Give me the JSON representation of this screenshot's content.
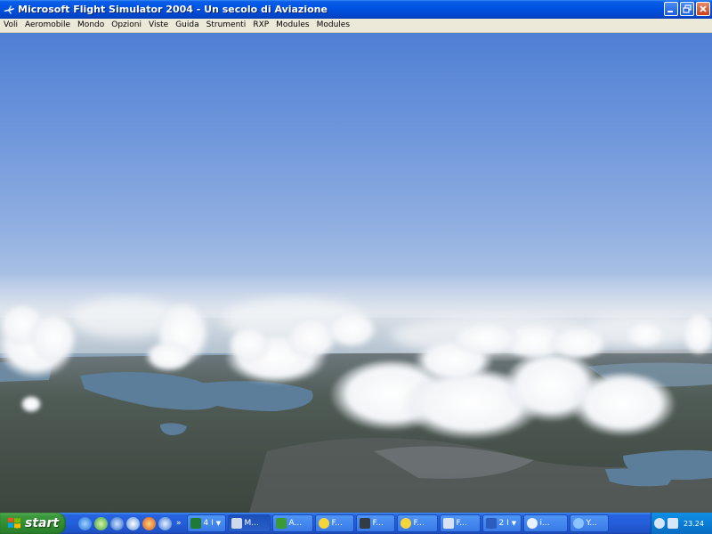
{
  "window": {
    "title": "Microsoft Flight Simulator 2004 - Un secolo di Aviazione",
    "buttons": [
      "minimize-icon",
      "restore-icon",
      "close-icon"
    ]
  },
  "menu": {
    "items": [
      "Voli",
      "Aeromobile",
      "Mondo",
      "Opzioni",
      "Viste",
      "Guida",
      "Strumenti",
      "RXP",
      "Modules",
      "Modules"
    ]
  },
  "taskbar": {
    "start_label": "start",
    "quick_launch_more": "»",
    "tasks": [
      {
        "label": "4 I",
        "icon": "excel-icon",
        "arrow": "▼"
      },
      {
        "label": "M...",
        "icon": "flight-simulator-icon",
        "active": true
      },
      {
        "label": "A...",
        "icon": "plant-icon"
      },
      {
        "label": "F...",
        "icon": "sun-icon"
      },
      {
        "label": "F...",
        "icon": "monitor-icon"
      },
      {
        "label": "F...",
        "icon": "sun-icon"
      },
      {
        "label": "F...",
        "icon": "plane-icon"
      },
      {
        "label": "2 I",
        "icon": "word-icon",
        "arrow": "▼"
      },
      {
        "label": "i...",
        "icon": "network-icon"
      },
      {
        "label": "Y...",
        "icon": "ie-icon"
      }
    ],
    "clock": "23.24"
  },
  "colors": {
    "titlebar": "#0054e3",
    "menubar": "#ece9d8",
    "taskbar": "#245edb",
    "start": "#3c9a3c",
    "tray": "#0b7dd6"
  }
}
